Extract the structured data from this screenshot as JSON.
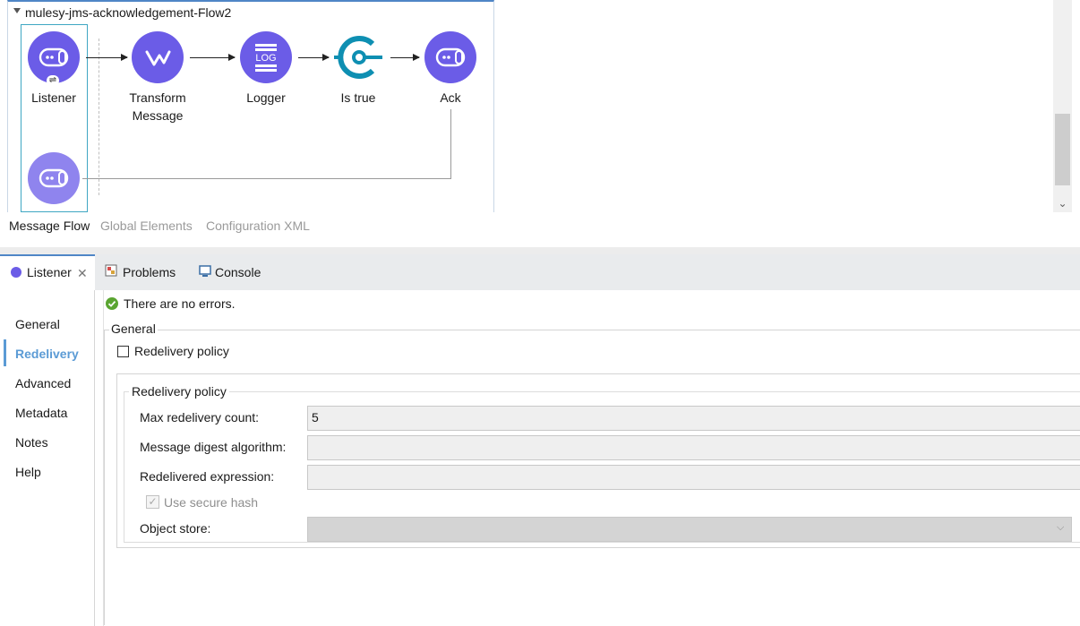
{
  "flow": {
    "title": "mulesy-jms-acknowledgement-Flow2",
    "nodes": [
      {
        "label": "Listener",
        "icon": "jms-connector-icon"
      },
      {
        "label": "Transform\nMessage",
        "icon": "transform-message-icon"
      },
      {
        "label": "Logger",
        "icon": "logger-icon"
      },
      {
        "label": "Is true",
        "icon": "validation-icon"
      },
      {
        "label": "Ack",
        "icon": "jms-connector-icon"
      }
    ]
  },
  "editor_tabs": [
    "Message Flow",
    "Global Elements",
    "Configuration XML"
  ],
  "panel_tabs": {
    "listener": "Listener",
    "problems": "Problems",
    "console": "Console"
  },
  "sidebar": [
    "General",
    "Redelivery",
    "Advanced",
    "Metadata",
    "Notes",
    "Help"
  ],
  "status": "There are no errors.",
  "general": {
    "title": "General",
    "redelivery_checkbox": "Redelivery policy",
    "policy_group_title": "Redelivery policy",
    "fields": {
      "max_redelivery_label": "Max redelivery count:",
      "max_redelivery_value": "5",
      "digest_label": "Message digest algorithm:",
      "digest_value": "",
      "expression_label": "Redelivered expression:",
      "expression_value": "",
      "secure_hash_label": "Use secure hash",
      "object_store_label": "Object store:",
      "object_store_value": ""
    }
  },
  "colors": {
    "connector": "#6b5ce7",
    "connector_light": "#8f84ee",
    "validation": "#0e8fb2",
    "active_tab": "#5b9bd5",
    "ok": "#5aa531"
  }
}
